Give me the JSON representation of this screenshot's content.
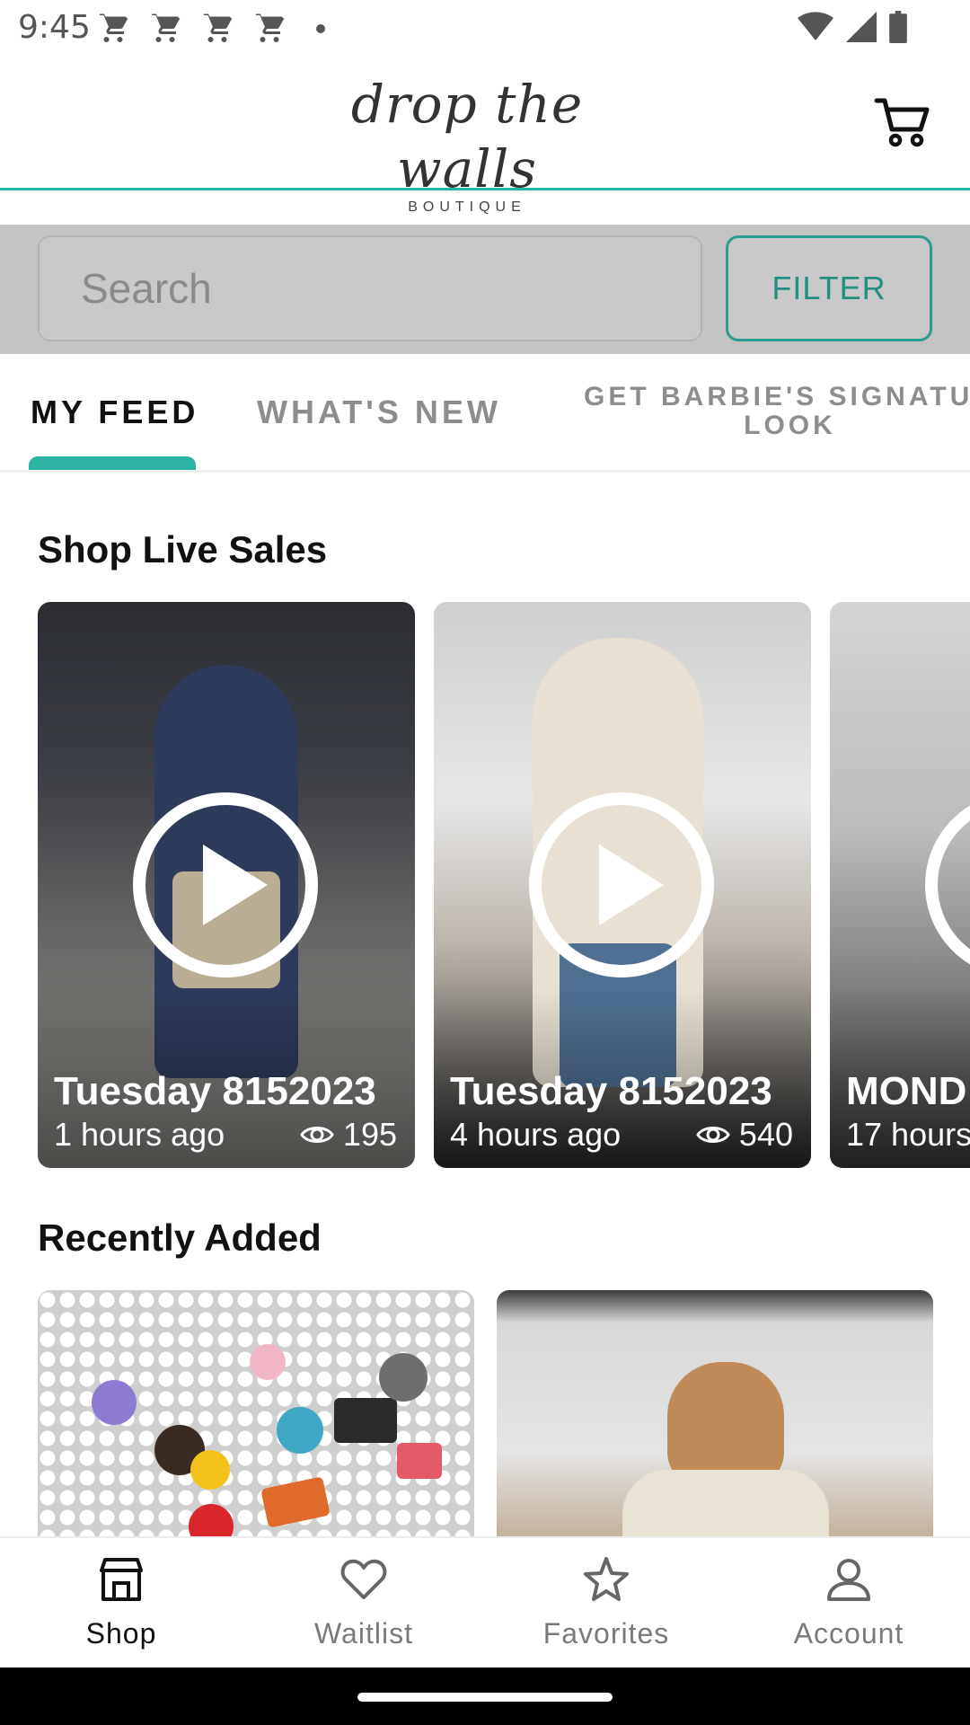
{
  "status_bar": {
    "time": "9:45",
    "left_icons": [
      "cart-icon",
      "cart-icon",
      "cart-icon",
      "cart-icon",
      "dot-icon"
    ],
    "right_icons": [
      "wifi-icon",
      "signal-icon",
      "battery-icon"
    ]
  },
  "header": {
    "logo_script": "drop the walls",
    "logo_sub": "BOUTIQUE",
    "cart_icon": "cart-icon"
  },
  "search": {
    "placeholder": "Search",
    "filter_label": "FILTER"
  },
  "tabs": [
    {
      "label": "MY FEED",
      "active": true
    },
    {
      "label": "WHAT'S NEW",
      "active": false
    },
    {
      "label_line1": "GET BARBIE'S SIGNATUR",
      "label_line2": "LOOK",
      "active": false
    }
  ],
  "sections": {
    "live_title": "Shop Live Sales",
    "recent_title": "Recently Added"
  },
  "live_sales": [
    {
      "title": "Tuesday 8152023",
      "time_ago": "1 hours ago",
      "views": "195"
    },
    {
      "title": "Tuesday 8152023",
      "time_ago": "4 hours ago",
      "views": "540"
    },
    {
      "title": "MOND",
      "time_ago": "17 hours",
      "views": ""
    }
  ],
  "bottom_nav": [
    {
      "label": "Shop",
      "icon": "store-icon",
      "active": true
    },
    {
      "label": "Waitlist",
      "icon": "heart-icon",
      "active": false
    },
    {
      "label": "Favorites",
      "icon": "star-icon",
      "active": false
    },
    {
      "label": "Account",
      "icon": "person-icon",
      "active": false
    }
  ],
  "colors": {
    "accent": "#2ab3a3",
    "filter_text": "#238f83",
    "search_band": "#c3c3c3",
    "inactive_tab": "#8d8d8d"
  }
}
